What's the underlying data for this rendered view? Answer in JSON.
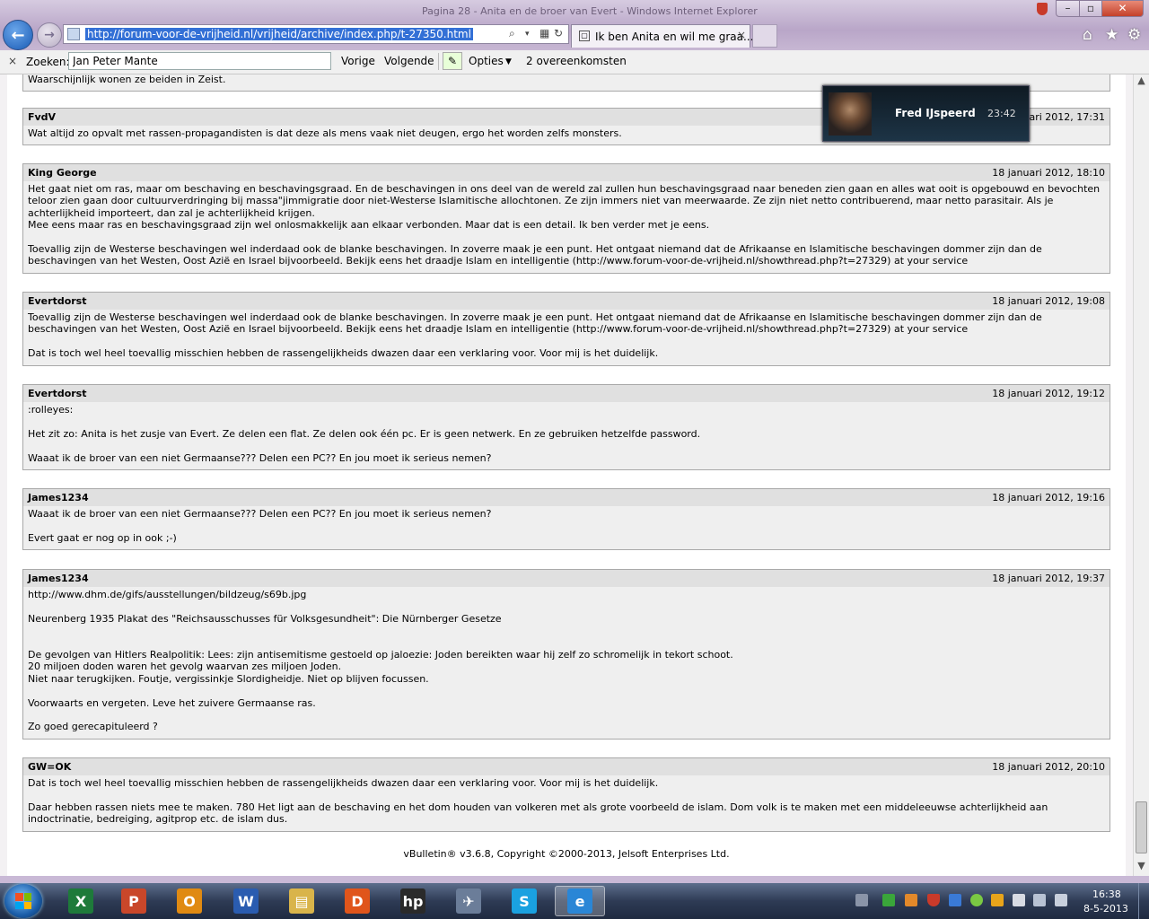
{
  "browser": {
    "window_title": "Pagina 28 - Anita en de broer van Evert - Windows Internet Explorer",
    "url": "http://forum-voor-de-vrijheid.nl/vrijheid/archive/index.php/t-27350.html",
    "tab_title": "Ik ben Anita en wil me graa...",
    "tab_close": "×"
  },
  "findbar": {
    "close": "×",
    "label": "Zoeken:",
    "value": "Jan Peter Mante",
    "prev": "Vorige",
    "next": "Volgende",
    "options": "Opties",
    "options_caret": "▼",
    "matches": "2 overeenkomsten"
  },
  "top_fragment": "Waarschijnlijk wonen ze beiden in Zeist.",
  "posts": [
    {
      "author": "FvdV",
      "date": "18 januari 2012, 17:31",
      "lines": [
        "Wat altijd zo opvalt met rassen-propagandisten is dat deze als mens vaak niet deugen, ergo het worden zelfs monsters."
      ]
    },
    {
      "author": "King George",
      "date": "18 januari 2012, 18:10",
      "lines": [
        "Het gaat niet om ras, maar om beschaving en beschavingsgraad. En de beschavingen in ons deel van de wereld zal zullen hun beschavingsgraad naar beneden zien gaan en alles wat ooit is opgebouwd en bevochten",
        "teloor zien gaan door cultuurverdringing bij massa\"jimmigratie door niet-Westerse Islamitische allochtonen. Ze zijn immers niet van meerwaarde. Ze zijn niet netto contribuerend, maar netto parasitair. Als je",
        "achterlijkheid importeert, dan zal je achterlijkheid krijgen.",
        "Mee eens maar ras en beschavingsgraad zijn wel onlosmakkelijk aan elkaar verbonden. Maar dat is een detail. Ik ben verder met je eens.",
        "",
        "Toevallig zijn de Westerse beschavingen wel inderdaad ook de blanke beschavingen. In zoverre maak je een punt. Het ontgaat niemand dat de Afrikaanse en Islamitische beschavingen dommer zijn dan de",
        "beschavingen van het Westen, Oost Azië en Israel bijvoorbeeld. Bekijk eens het draadje Islam en intelligentie (http://www.forum-voor-de-vrijheid.nl/showthread.php?t=27329) at your service"
      ]
    },
    {
      "author": "Evertdorst",
      "date": "18 januari 2012, 19:08",
      "lines": [
        "Toevallig zijn de Westerse beschavingen wel inderdaad ook de blanke beschavingen. In zoverre maak je een punt. Het ontgaat niemand dat de Afrikaanse en Islamitische beschavingen dommer zijn dan de",
        "beschavingen van het Westen, Oost Azië en Israel bijvoorbeeld. Bekijk eens het draadje Islam en intelligentie (http://www.forum-voor-de-vrijheid.nl/showthread.php?t=27329) at your service",
        "",
        "Dat is toch wel heel toevallig misschien hebben de rassengelijkheids dwazen daar een verklaring voor. Voor mij is het duidelijk."
      ]
    },
    {
      "author": "Evertdorst",
      "date": "18 januari 2012, 19:12",
      "lines": [
        ":rolleyes:",
        "",
        "Het zit zo: Anita is het zusje van Evert. Ze delen een flat. Ze delen ook één pc. Er is geen netwerk. En ze gebruiken hetzelfde password.",
        "",
        "Waaat ik de broer van een niet Germaanse??? Delen een PC?? En jou moet ik serieus nemen?"
      ]
    },
    {
      "author": "James1234",
      "date": "18 januari 2012, 19:16",
      "lines": [
        "Waaat ik de broer van een niet Germaanse??? Delen een PC?? En jou moet ik serieus nemen?",
        "",
        "Evert gaat er nog op in ook ;-)"
      ]
    },
    {
      "author": "James1234",
      "date": "18 januari 2012, 19:37",
      "lines": [
        "http://www.dhm.de/gifs/ausstellungen/bildzeug/s69b.jpg",
        "",
        "Neurenberg 1935 Plakat des \"Reichsausschusses für Volksgesundheit\": Die Nürnberger Gesetze",
        "",
        "",
        "De gevolgen van Hitlers Realpolitik: Lees: zijn antisemitisme gestoeld op jaloezie: Joden bereikten waar hij zelf zo schromelijk in tekort schoot.",
        "20 miljoen doden waren het gevolg waarvan zes miljoen Joden.",
        "Niet naar terugkijken. Foutje, vergissinkje Slordigheidje. Niet op blijven focussen.",
        "",
        "Voorwaarts en vergeten. Leve het zuivere Germaanse ras.",
        "",
        "Zo goed gerecapituleerd ?"
      ]
    },
    {
      "author": "GW=OK",
      "date": "18 januari 2012, 20:10",
      "lines": [
        "Dat is toch wel heel toevallig misschien hebben de rassengelijkheids dwazen daar een verklaring voor. Voor mij is het duidelijk.",
        "",
        "Daar hebben rassen niets mee te maken. 780 Het ligt aan de beschaving en het dom houden van volkeren met als grote voorbeeld de islam. Dom volk is te maken met een middeleeuwse achterlijkheid aan",
        "indoctrinatie, bedreiging, agitprop etc. de islam dus."
      ]
    }
  ],
  "footer": "vBulletin® v3.6.8, Copyright ©2000-2013, Jelsoft Enterprises Ltd.",
  "notification": {
    "name": "Fred IJspeerd",
    "time": "23:42"
  },
  "taskbar": {
    "apps": [
      {
        "name": "excel",
        "glyph": "X",
        "color": "#1e7a3a"
      },
      {
        "name": "powerpoint",
        "glyph": "P",
        "color": "#c9472a"
      },
      {
        "name": "outlook",
        "glyph": "O",
        "color": "#e08a12"
      },
      {
        "name": "word",
        "glyph": "W",
        "color": "#2a5cb0"
      },
      {
        "name": "explorer",
        "glyph": "▤",
        "color": "#d9b44a"
      },
      {
        "name": "d-app",
        "glyph": "D",
        "color": "#e0551b"
      },
      {
        "name": "hp",
        "glyph": "hp",
        "color": "#2a2a2a"
      },
      {
        "name": "network",
        "glyph": "✈",
        "color": "#6b7d99"
      },
      {
        "name": "skype",
        "glyph": "S",
        "color": "#1aa1e0"
      },
      {
        "name": "internet-explorer",
        "glyph": "e",
        "color": "#2a86d6"
      }
    ],
    "clock_time": "16:38",
    "clock_date": "8-5-2013"
  }
}
